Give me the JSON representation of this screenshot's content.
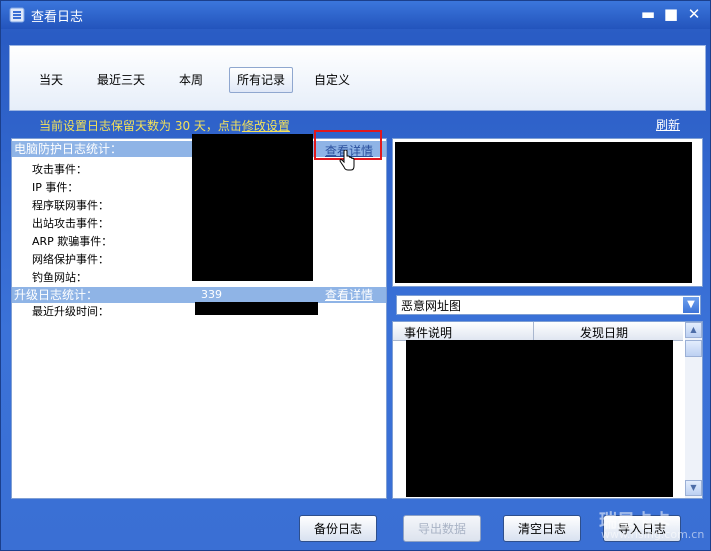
{
  "window": {
    "title": "查看日志"
  },
  "tabs": [
    {
      "label": "当天"
    },
    {
      "label": "最近三天"
    },
    {
      "label": "本周"
    },
    {
      "label": "所有记录"
    },
    {
      "label": "自定义"
    }
  ],
  "notice": {
    "prefix": "当前设置日志保留天数为 30 天，点击",
    "link": "修改设置"
  },
  "refresh_label": "刷新",
  "protection": {
    "header": "电脑防护日志统计：",
    "detail_link": "查看详情",
    "rows": [
      "攻击事件：",
      "IP 事件：",
      "程序联网事件：",
      "出站攻击事件：",
      "ARP 欺骗事件：",
      "网络保护事件：",
      "钓鱼网站："
    ]
  },
  "upgrade": {
    "header": "升级日志统计：",
    "count": "339",
    "detail_link": "查看详情",
    "last_time_label": "最近升级时间："
  },
  "chart_select": {
    "value": "恶意网址图"
  },
  "event_table": {
    "columns": [
      "事件说明",
      "发现日期"
    ]
  },
  "buttons": {
    "backup": "备份日志",
    "export": "导出数据",
    "clear": "清空日志",
    "import": "导入日志"
  },
  "watermark": {
    "main": "瑞星卡卡",
    "sub": "www.rising.com.cn"
  },
  "colors": {
    "accent_red": "#e1181d",
    "notice_yellow": "#f3e15a",
    "section_blue": "#8fb4e6"
  }
}
